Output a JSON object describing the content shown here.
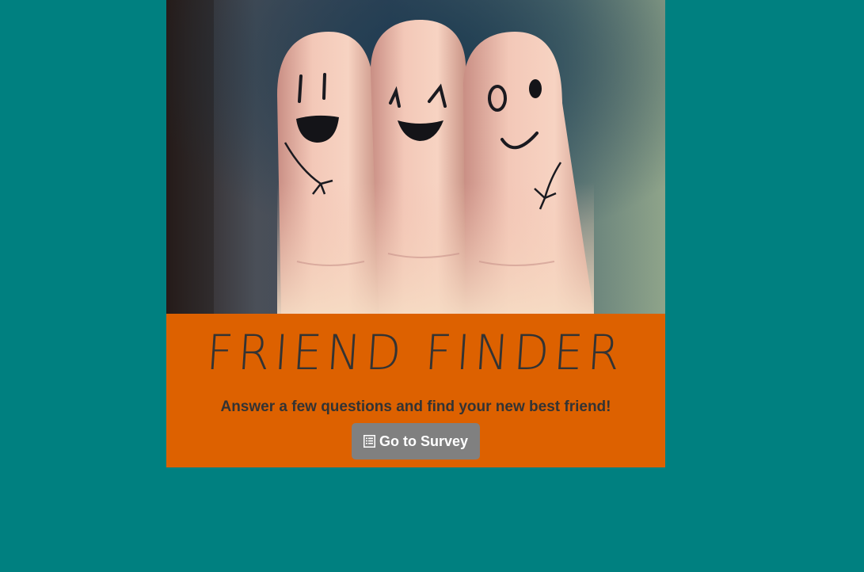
{
  "hero": {
    "image_description_icon": "hero-image"
  },
  "header": {
    "title": "FRIEND FINDER",
    "subtitle": "Answer a few questions and find your new best friend!"
  },
  "actions": {
    "survey_label": "Go to Survey",
    "survey_icon": "list-alt-icon"
  },
  "colors": {
    "background": "#008080",
    "jumbotron": "#dd6100",
    "button": "#808080",
    "text": "#333333"
  }
}
